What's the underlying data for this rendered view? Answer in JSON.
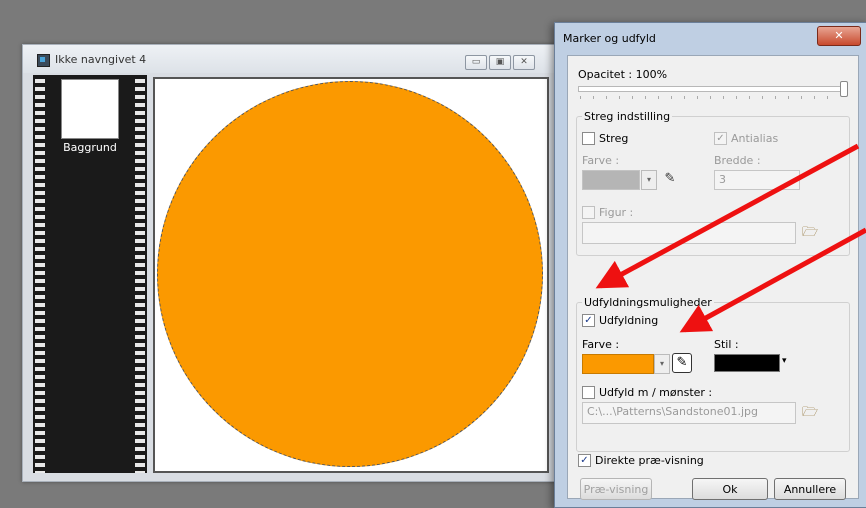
{
  "image_window": {
    "title": "Ikke navngivet 4",
    "layer_name": "Baggrund",
    "buttons": [
      "▭",
      "▣",
      "✕"
    ]
  },
  "dialog": {
    "title": "Marker og udfyld",
    "close": "✕",
    "opacity_label": "Opacitet : 100%",
    "opacity_value": 100,
    "stroke_group": {
      "title": "Streg indstilling",
      "stroke_label": "Streg",
      "stroke_checked": false,
      "antialias_label": "Antialias",
      "antialias_checked": true,
      "color_label": "Farve :",
      "width_label": "Bredde :",
      "width_value": "3",
      "shape_label": "Figur :",
      "shape_checked": false
    },
    "fill_group": {
      "title": "Udfyldningsmuligheder",
      "fill_label": "Udfyldning",
      "fill_checked": true,
      "color_label": "Farve :",
      "color_value": "#fb9900",
      "style_label": "Stil :",
      "style_value": "#000000",
      "pattern_label": "Udfyld m / mønster :",
      "pattern_checked": false,
      "pattern_path": "C:\\...\\Patterns\\Sandstone01.jpg"
    },
    "preview_label": "Direkte præ-visning",
    "preview_checked": true,
    "preview_button": "Præ-visning",
    "ok_button": "Ok",
    "cancel_button": "Annullere"
  },
  "colors": {
    "fill_orange": "#fb9900",
    "arrow_red": "#ee1111"
  }
}
